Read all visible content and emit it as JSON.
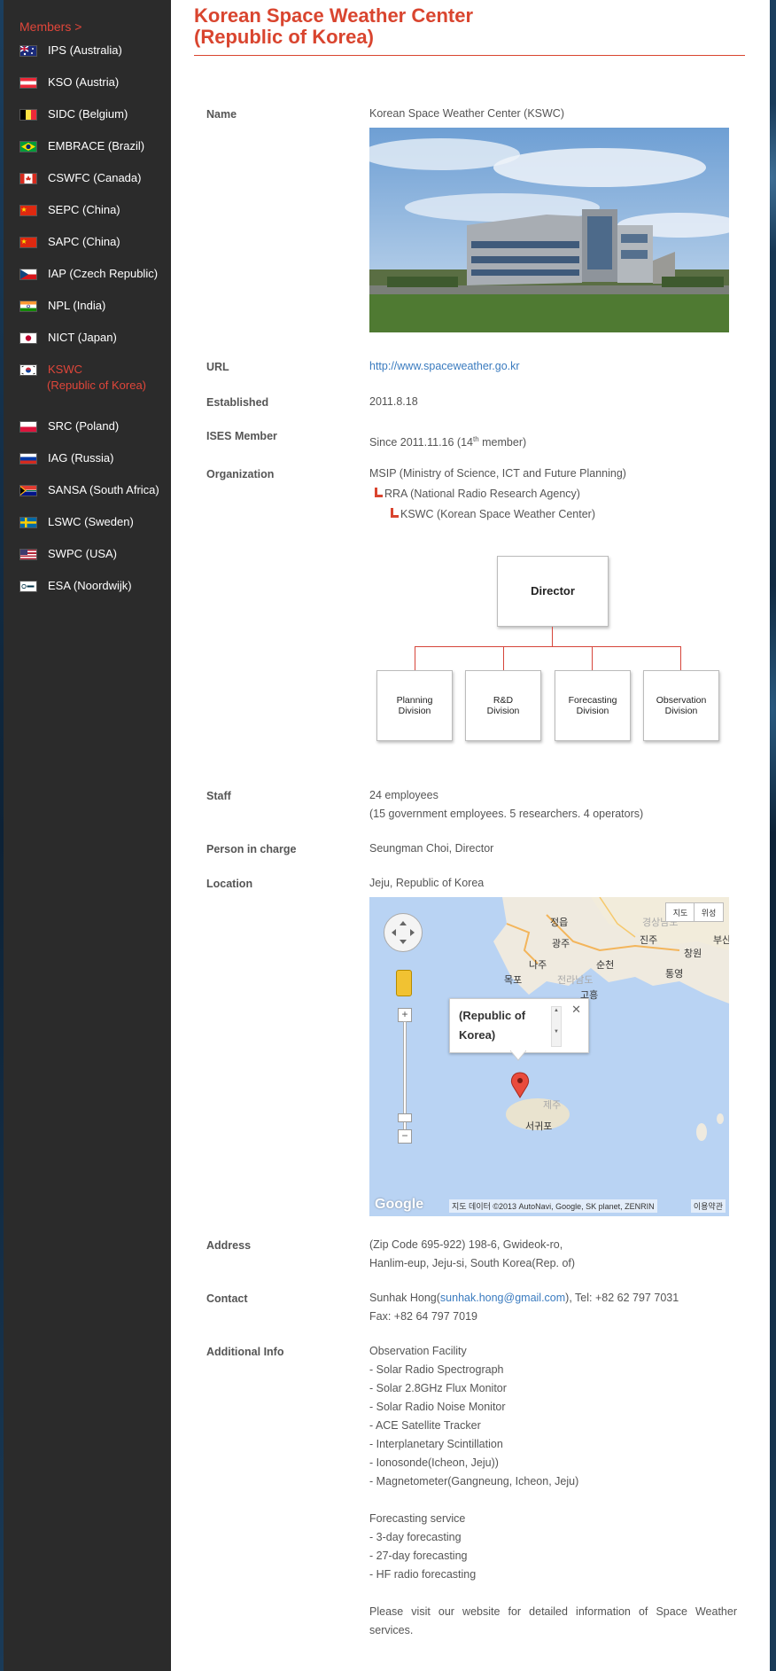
{
  "sidebar": {
    "title": "Members >",
    "items": [
      {
        "label": "IPS (Australia)"
      },
      {
        "label": "KSO (Austria)"
      },
      {
        "label": "SIDC (Belgium)"
      },
      {
        "label": "EMBRACE (Brazil)"
      },
      {
        "label": "CSWFC (Canada)"
      },
      {
        "label": "SEPC (China)"
      },
      {
        "label": "SAPC (China)"
      },
      {
        "label": "IAP (Czech Republic)"
      },
      {
        "label": "NPL (India)"
      },
      {
        "label": "NICT (Japan)"
      },
      {
        "label": "KSWC",
        "label2": "(Republic of Korea)",
        "active": true
      },
      {
        "label": "SRC (Poland)"
      },
      {
        "label": "IAG (Russia)"
      },
      {
        "label": "SANSA (South Africa)"
      },
      {
        "label": "LSWC (Sweden)"
      },
      {
        "label": "SWPC (USA)"
      },
      {
        "label": "ESA (Noordwijk)"
      }
    ]
  },
  "page": {
    "title_line1": "Korean Space Weather Center",
    "title_line2": "(Republic of Korea)"
  },
  "fields": {
    "name_label": "Name",
    "name_value": "Korean Space Weather Center (KSWC)",
    "url_label": "URL",
    "url_value": "http://www.spaceweather.go.kr",
    "established_label": "Established",
    "established_value": "2011.8.18",
    "ises_label": "ISES Member",
    "ises_prefix": "Since 2011.11.16 (14",
    "ises_sup": "th",
    "ises_suffix": " member)",
    "org_label": "Organization",
    "org_line1": "MSIP (Ministry of Science, ICT and Future Planning)",
    "org_line2": "RRA (National Radio Research Agency)",
    "org_line3": "KSWC (Korean Space Weather Center)",
    "staff_label": "Staff",
    "staff_line1": "24 employees",
    "staff_line2": "(15 government employees. 5 researchers. 4 operators)",
    "person_label": "Person in charge",
    "person_value": "Seungman Choi, Director",
    "location_label": "Location",
    "location_value": "Jeju, Republic of Korea",
    "address_label": "Address",
    "address_line1": "(Zip Code 695-922) 198-6, Gwideok-ro,",
    "address_line2": "Hanlim-eup, Jeju-si, South Korea(Rep. of)",
    "contact_label": "Contact",
    "contact_name": "Sunhak Hong(",
    "contact_email": "sunhak.hong@gmail.com",
    "contact_tel": "), Tel: +82 62 797 7031",
    "contact_fax": "Fax: +82 64 797 7019",
    "additional_label": "Additional Info",
    "additional_lines": [
      "Observation Facility",
      "- Solar Radio Spectrograph",
      "- Solar 2.8GHz Flux Monitor",
      "- Solar Radio Noise Monitor",
      "- ACE Satellite Tracker",
      "- Interplanetary Scintillation",
      "- Ionosonde(Icheon, Jeju))",
      "- Magnetometer(Gangneung, Icheon, Jeju)",
      "",
      "Forecasting service",
      "- 3-day forecasting",
      "- 27-day forecasting",
      "- HF radio forecasting"
    ],
    "visit_note": "Please visit our website for detailed information of Space Weather services."
  },
  "org_chart": {
    "director": "Director",
    "divisions": [
      {
        "line1": "Planning",
        "line2": "Division"
      },
      {
        "line1": "R&D",
        "line2": "Division"
      },
      {
        "line1": "Forecasting",
        "line2": "Division"
      },
      {
        "line1": "Observation",
        "line2": "Division"
      }
    ]
  },
  "map": {
    "btn_map": "지도",
    "btn_satellite": "위성",
    "infowindow_text": "(Republic of Korea)",
    "place_labels": [
      "정읍",
      "광주",
      "나주",
      "순천",
      "진주",
      "창원",
      "통영",
      "목포",
      "전라남도",
      "고흥",
      "경상남도",
      "제주",
      "서귀포",
      "부산"
    ],
    "attribution": "지도 데이터 ©2013 AutoNavi, Google, SK planet, ZENRIN",
    "terms": "이용약관",
    "logo": "Google"
  },
  "colors": {
    "accent": "#d9452f",
    "link": "#3a7bbf",
    "sidebar_bg": "#2b2b2b"
  }
}
